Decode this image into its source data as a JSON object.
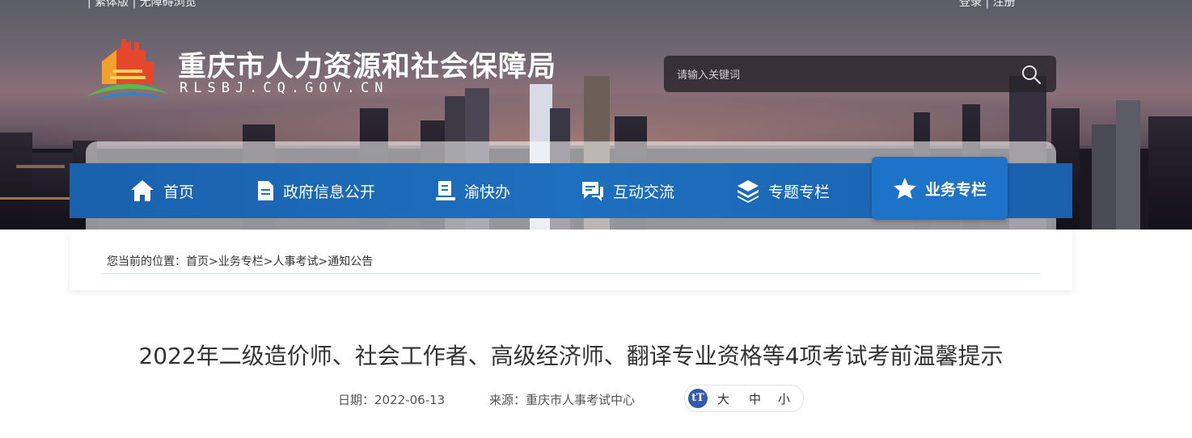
{
  "header": {
    "top_left_links": "| 繁体版 | 无障碍浏览",
    "top_right_links": "登录 | 注册",
    "site_title": "重庆市人力资源和社会保障局",
    "site_domain": "RLSBJ.CQ.GOV.CN",
    "search": {
      "placeholder": "请输入关键词",
      "value": ""
    }
  },
  "nav": {
    "items": [
      {
        "label": "首页",
        "icon": "home-icon"
      },
      {
        "label": "政府信息公开",
        "icon": "document-icon"
      },
      {
        "label": "渝快办",
        "icon": "service-icon"
      },
      {
        "label": "互动交流",
        "icon": "chat-icon"
      },
      {
        "label": "专题专栏",
        "icon": "layers-icon"
      },
      {
        "label": "业务专栏",
        "icon": "star-icon",
        "active": true
      }
    ]
  },
  "breadcrumb": {
    "prefix": "您当前的位置：",
    "items": [
      "首页",
      "业务专栏",
      "人事考试",
      "通知公告"
    ],
    "separator": ">"
  },
  "article": {
    "title": "2022年二级造价师、社会工作者、高级经济师、翻译专业资格等4项考试考前温馨提示",
    "date_label": "日期：",
    "date": "2022-06-13",
    "source_label": "来源：",
    "source": "重庆市人事考试中心",
    "font_size_icon_text": "tT",
    "font_sizes": [
      "大",
      "中",
      "小"
    ]
  },
  "colors": {
    "nav_blue": "#1e6fbf",
    "nav_active": "#1d73c8",
    "title_text": "#333333"
  }
}
